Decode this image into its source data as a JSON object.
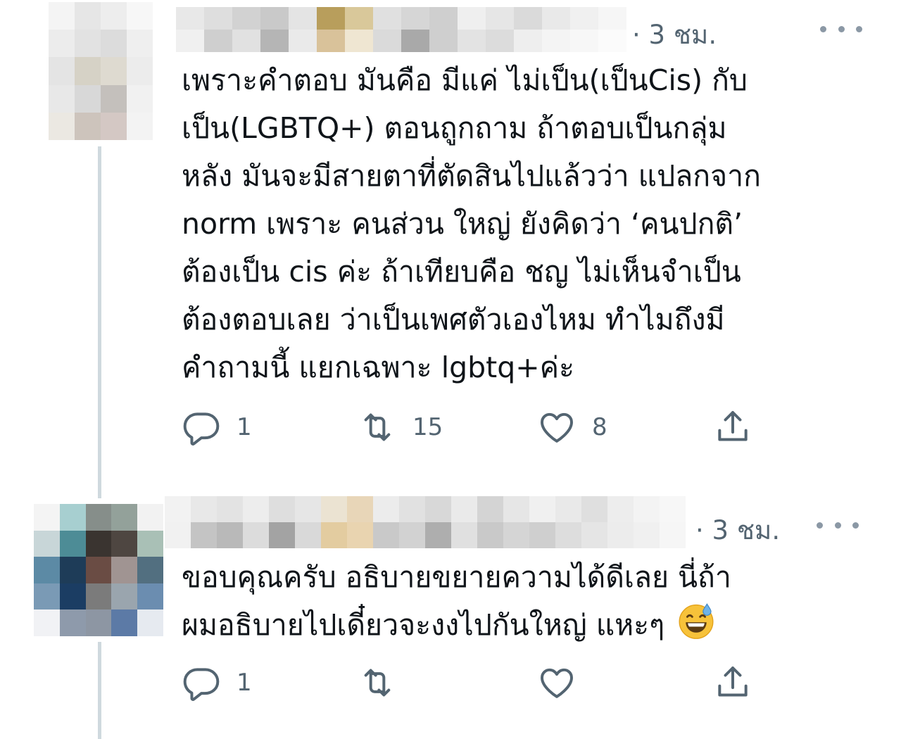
{
  "tweets": [
    {
      "id": "tweet-1",
      "timestamp": "· 3 ชม.",
      "text": "เพราะคำตอบ มันคือ มีแค่ ไม่เป็น(เป็นCis) กับ\nเป็น(LGBTQ+) ตอนถูกถาม ถ้าตอบเป็นกลุ่ม\nหลัง มันจะมีสายตาที่ตัดสินไปแล้วว่า แปลกจาก\nnorm เพราะ คนส่วน ใหญ่ ยังคิดว่า ‘คนปกติ’\nต้องเป็น cis ค่ะ ถ้าเทียบคือ ชญ ไม่เห็นจำเป็น\nต้องตอบเลย ว่าเป็นเพศตัวเองไหม ทำไมถึงมี\nคำถามนี้ แยกเฉพาะ lgbtq+ค่ะ",
      "reply_count": "1",
      "retweet_count": "15",
      "like_count": "8",
      "avatar_colors": [
        "#f4f4f4",
        "#e6e6e6",
        "#ededed",
        "#f7f7f7",
        "#ececec",
        "#e2e2e2",
        "#dcdcdc",
        "#efefef",
        "#e4e4e4",
        "#d6d2c6",
        "#dedad0",
        "#ececec",
        "#e8e8e8",
        "#d8d8d8",
        "#c4c0bc",
        "#f1f1f1",
        "#ebe8e2",
        "#cdc4bc",
        "#d4c8c4",
        "#f3f3f3"
      ],
      "name_colors": [
        "#e8e8e8",
        "#dedede",
        "#d2d2d2",
        "#c9c9c9",
        "#e4e4e4",
        "#b89e5c",
        "#d9c89a",
        "#e0e0e0",
        "#d6d6d6",
        "#cfcfcf",
        "#efefef",
        "#e6e6e6",
        "#dadada",
        "#e9e9e9",
        "#f0f0f0",
        "#f6f6f6",
        "#f0f0f0",
        "#cfcfcf",
        "#e1e1e1",
        "#b5b5b5",
        "#eaeaea",
        "#d9c29a",
        "#efe6d2",
        "#dadada",
        "#a9a9a9",
        "#cfcfcf",
        "#e3e3e3",
        "#dcdcdc",
        "#eeeeee",
        "#f4f4f4",
        "#f7f7f7",
        "#fbfbfb"
      ]
    },
    {
      "id": "tweet-2",
      "timestamp": "· 3 ชม.",
      "text": "ขอบคุณครับ อธิบายขยายความได้ดีเลย นี่ถ้า\nผมอธิบายไปเดี๋ยวจะงงไปกันใหญ่ แหะๆ",
      "reply_count": "1",
      "retweet_count": "",
      "like_count": "",
      "avatar_colors": [
        "#f4f4f4",
        "#a7cfd0",
        "#868e8a",
        "#93a19a",
        "#f2f2f2",
        "#c8d6d8",
        "#4d8c96",
        "#3a3430",
        "#4e4641",
        "#a9c0b6",
        "#5c8aa5",
        "#1e3c58",
        "#6a4c44",
        "#a09492",
        "#526f80",
        "#7a9ab5",
        "#1b3d63",
        "#7b7b7b",
        "#9aa5ae",
        "#6b8db0",
        "#f1f2f5",
        "#8e9aab",
        "#8d96a3",
        "#5c7aa6",
        "#e6eaf0"
      ],
      "name_colors": [
        "#f2f2f2",
        "#e8e8e8",
        "#e3e3e3",
        "#ededed",
        "#dedede",
        "#e6e6e6",
        "#ebe3d2",
        "#e8d6b8",
        "#ececec",
        "#e1e1e1",
        "#d8d8d8",
        "#eaeaea",
        "#d4d4d4",
        "#e6e6e6",
        "#f0f0f0",
        "#e9e9e9",
        "#dfdfdf",
        "#ededed",
        "#f3f3f3",
        "#f7f7f7",
        "#f1f1f1",
        "#c4c4c4",
        "#b9b9b9",
        "#dcdcdc",
        "#a3a3a3",
        "#d9d9d9",
        "#e3cca0",
        "#e9d4b0",
        "#c9c9c9",
        "#d2d2d2",
        "#aeaeae",
        "#e0e0e0",
        "#c9c9c9",
        "#d5d5d5",
        "#cfcfcf",
        "#dddddd",
        "#e5e5e5",
        "#ececec",
        "#f0f0f0",
        "#f6f6f6"
      ]
    }
  ],
  "icons": {
    "reply": "reply-icon",
    "retweet": "retweet-icon",
    "like": "like-icon",
    "share": "share-icon",
    "more": "more-icon",
    "emoji": "grinning-sweat-emoji"
  },
  "colors": {
    "text": "#0f1419",
    "muted": "#536471",
    "thread_line": "#cfd9de"
  }
}
